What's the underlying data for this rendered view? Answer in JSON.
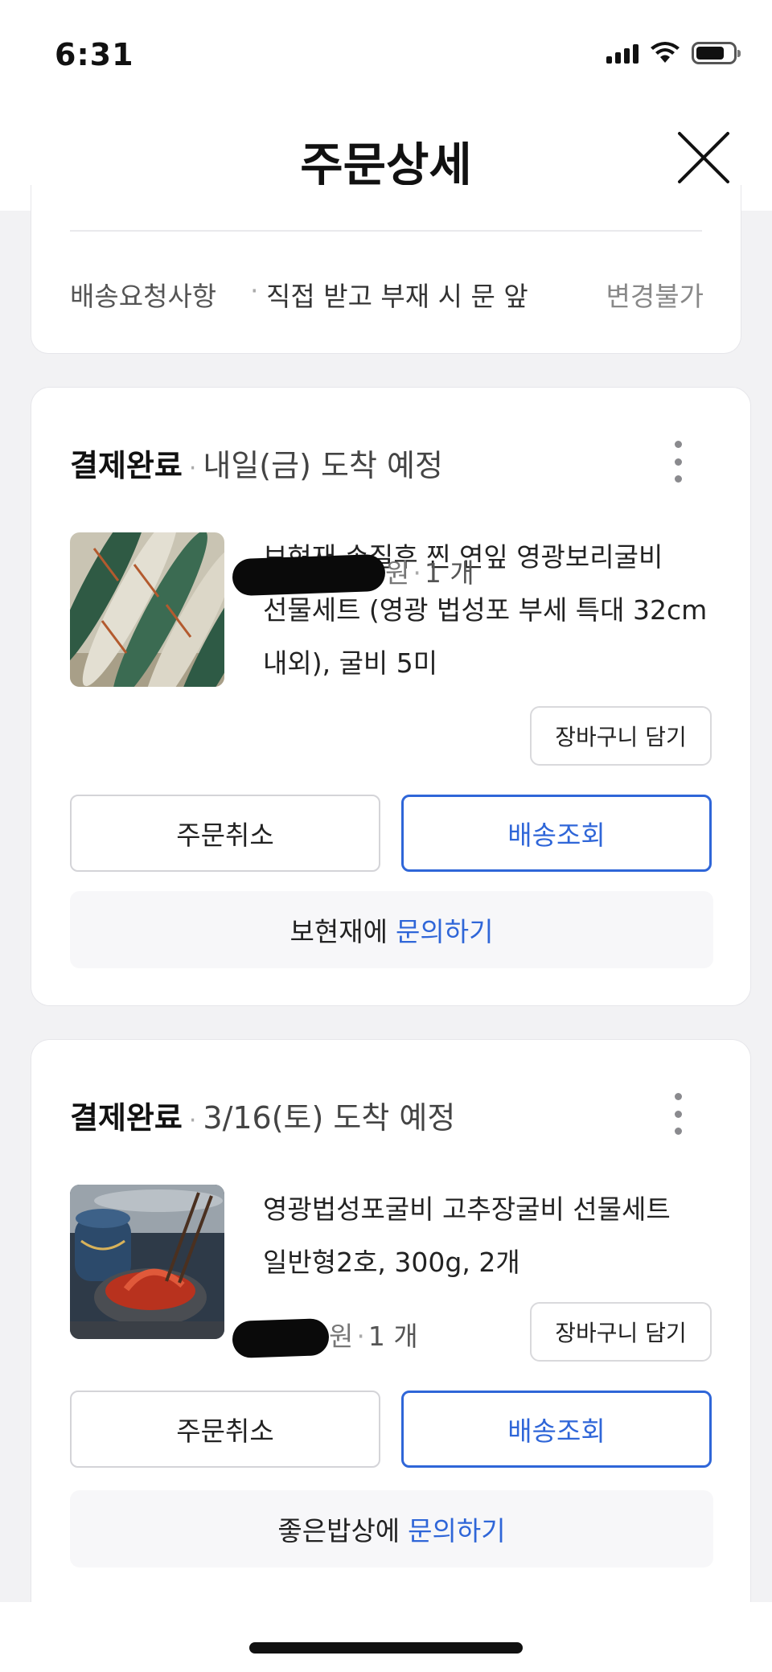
{
  "status_bar": {
    "time": "6:31"
  },
  "header": {
    "title": "주문상세",
    "close_icon": "close-icon"
  },
  "delivery_request": {
    "label": "배송요청사항",
    "bullet": "·",
    "value": "직접 받고 부재 시 문 앞",
    "status": "변경불가"
  },
  "orders": [
    {
      "status": "결제완료",
      "separator": "·",
      "eta": "내일(금) 도착 예정",
      "product_name": "보현재 손질후 찐 연잎 영광보리굴비 선물세트 (영광 법성포 부세 특대 32cm 내외), 굴비 5미",
      "price_suffix": "원",
      "quantity": "1 개",
      "cart_button": "장바구니 담기",
      "cancel_button": "주문취소",
      "track_button": "배송조회",
      "seller": "보현재에",
      "inquiry_link": "문의하기"
    },
    {
      "status": "결제완료",
      "separator": "·",
      "eta": "3/16(토) 도착 예정",
      "product_name": "영광법성포굴비 고추장굴비 선물세트 일반형2호, 300g, 2개",
      "price_suffix": "원",
      "quantity": "1 개",
      "cart_button": "장바구니 담기",
      "cancel_button": "주문취소",
      "track_button": "배송조회",
      "seller": "좋은밥상에",
      "inquiry_link": "문의하기"
    }
  ],
  "colors": {
    "accent": "#2f66d8",
    "background": "#f2f2f4",
    "card": "#ffffff"
  }
}
